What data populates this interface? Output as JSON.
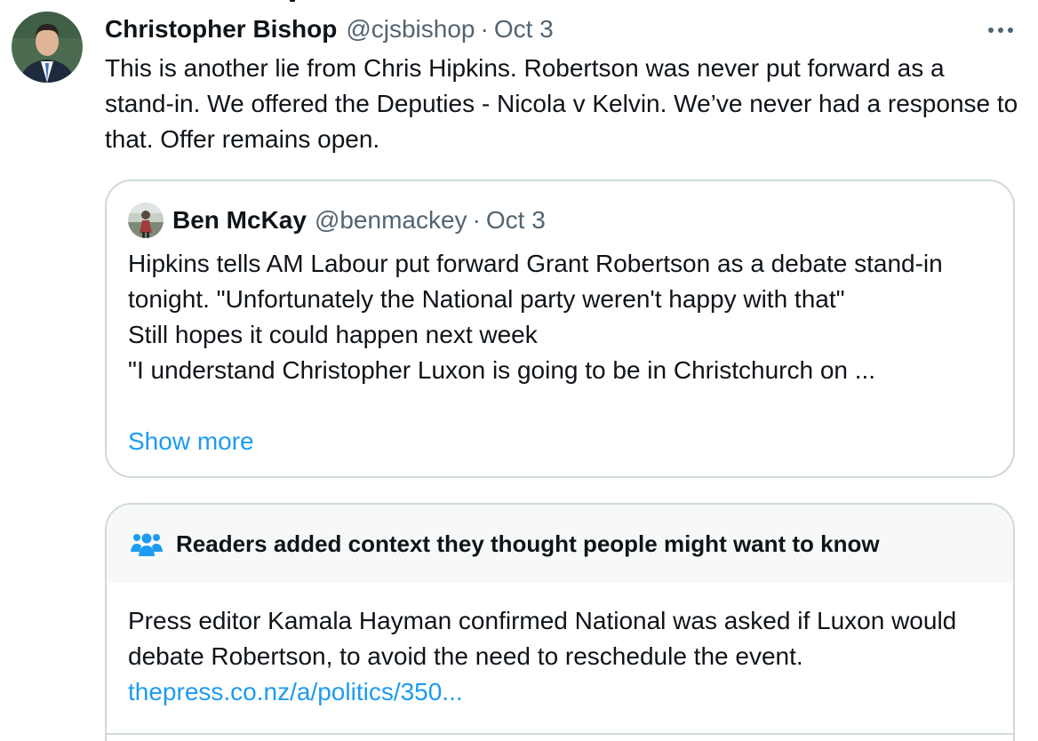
{
  "tweet": {
    "author_name": "Christopher Bishop",
    "author_handle": "@cjsbishop",
    "separator": "·",
    "date": "Oct 3",
    "more_icon": "ellipsis-horizontal-icon",
    "text": "This is another lie from Chris Hipkins. Robertson was never put forward as a stand-in. We offered the Deputies - Nicola v Kelvin. We’ve never had a response to that. Offer remains open."
  },
  "quote": {
    "author_name": "Ben McKay",
    "author_handle": "@benmackey",
    "separator": "·",
    "date": "Oct 3",
    "lines": [
      "Hipkins tells AM Labour put forward Grant Robertson as a debate stand-in tonight. \"Unfortunately the National party weren't happy with that\"",
      "Still hopes it could happen next week",
      "\"I understand Christopher Luxon is going to be in Christchurch on ..."
    ],
    "show_more_label": "Show more"
  },
  "community_note": {
    "icon": "people-icon",
    "title": "Readers added context they thought people might want to know",
    "body": "Press editor Kamala Hayman confirmed National was asked if Luxon would debate Robertson, to avoid the need to reschedule the event.",
    "link_text": "thepress.co.nz/a/politics/350..."
  },
  "colors": {
    "text_primary": "#0f1419",
    "text_secondary": "#536471",
    "link": "#1d9bf0",
    "border": "#cfd9de",
    "note_header_bg": "#f7f9f9"
  }
}
